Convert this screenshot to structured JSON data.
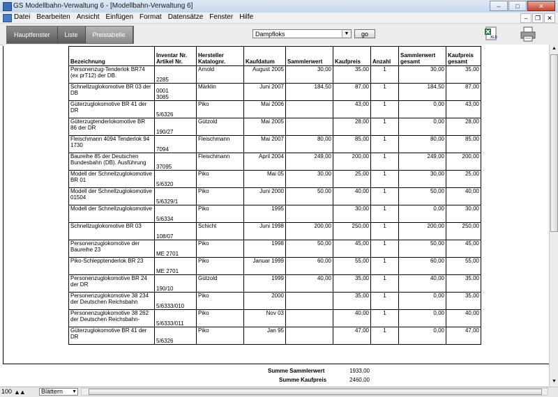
{
  "window": {
    "title": "GS Modellbahn-Verwaltung 6 - [Modellbahn-Verwaltung 6]",
    "buttons": {
      "min": "–",
      "max": "□",
      "close": "✕"
    }
  },
  "menu": [
    "Datei",
    "Bearbeiten",
    "Ansicht",
    "Einfügen",
    "Format",
    "Datensätze",
    "Fenster",
    "Hilfe"
  ],
  "mdi_buttons": {
    "min": "–",
    "restore": "❐",
    "close": "✕"
  },
  "tabs": [
    {
      "label": "Hauptfenster",
      "active": false
    },
    {
      "label": "Liste",
      "active": false
    },
    {
      "label": "Preistabelle",
      "active": true
    }
  ],
  "filter": {
    "selected": "Dampfloks",
    "go_label": "go"
  },
  "icons": {
    "xls": "excel-export-icon",
    "print": "printer-icon"
  },
  "columns": {
    "bezeichnung": "Bezeichnung",
    "inventar_l1": "Inventar Nr.",
    "inventar_l2": "Artikel Nr.",
    "hersteller_l1": "Hersteller",
    "hersteller_l2": "Katalognr.",
    "kaufdatum": "Kaufdatum",
    "sammlerwert": "Sammlerwert",
    "kaufpreis": "Kaufpreis",
    "anzahl": "Anzahl",
    "sammlerwert_gesamt_l1": "Sammlerwert",
    "sammlerwert_gesamt_l2": "gesamt",
    "kaufpreis_gesamt_l1": "Kaufpreis",
    "kaufpreis_gesamt_l2": "gesamt"
  },
  "rows": [
    {
      "bez": "Personenzug-Tenderlok BR74 (ex prT12) der DB.",
      "inv1": "",
      "inv2": "2285",
      "hersteller": "Arnold",
      "datum": "August 2005",
      "sammler": "30,00",
      "kauf": "35,00",
      "anzahl": "1",
      "sg": "30,00",
      "kg": "35,00"
    },
    {
      "bez": "Schnellzuglokomotive BR 03 der DB",
      "inv1": "0001",
      "inv2": "3085",
      "hersteller": "Märklin",
      "datum": "Juni 2007",
      "sammler": "184,50",
      "kauf": "87,00",
      "anzahl": "1",
      "sg": "184,50",
      "kg": "87,00"
    },
    {
      "bez": "Güterzuglokomotive BR 41 der DR",
      "inv1": "",
      "inv2": "5/6326",
      "hersteller": "Piko",
      "datum": "Mai 2006",
      "sammler": "",
      "kauf": "43,00",
      "anzahl": "1",
      "sg": "0,00",
      "kg": "43,00"
    },
    {
      "bez": "Güterzugtenderlokomotive BR 86 der DR",
      "inv1": "",
      "inv2": "190/27",
      "hersteller": "Gützold",
      "datum": "Mai 2005",
      "sammler": "",
      "kauf": "28,00",
      "anzahl": "1",
      "sg": "0,00",
      "kg": "28,00"
    },
    {
      "bez": "Fleischmann 4094 Tenderlok 94 1730",
      "inv1": "",
      "inv2": "7094",
      "hersteller": "Fleischmann",
      "datum": "Mai 2007",
      "sammler": "80,00",
      "kauf": "85,00",
      "anzahl": "1",
      "sg": "80,00",
      "kg": "85,00"
    },
    {
      "bez": "Baureihe 85 der Deutschen Bundesbahn (DB). Ausführung",
      "inv1": "",
      "inv2": "37095",
      "hersteller": "Fleischmann",
      "datum": "April 2004",
      "sammler": "249,00",
      "kauf": "200,00",
      "anzahl": "1",
      "sg": "249,00",
      "kg": "200,00"
    },
    {
      "bez": "Modell der Schnellzuglokomotive BR 01",
      "inv1": "",
      "inv2": "5/6320",
      "hersteller": "Piko",
      "datum": "Mai 05",
      "sammler": "30,00",
      "kauf": "25,00",
      "anzahl": "1",
      "sg": "30,00",
      "kg": "25,00"
    },
    {
      "bez": "Modell der Schnellzuglokomotive 01504",
      "inv1": "",
      "inv2": "5/6329/1",
      "hersteller": "Piko",
      "datum": "Juni 2000",
      "sammler": "50,00",
      "kauf": "40,00",
      "anzahl": "1",
      "sg": "50,00",
      "kg": "40,00"
    },
    {
      "bez": "Modell der Schnellzuglokomotive",
      "inv1": "",
      "inv2": "5/6334",
      "hersteller": "Piko",
      "datum": "1995",
      "sammler": "",
      "kauf": "30,00",
      "anzahl": "1",
      "sg": "0,00",
      "kg": "30,00"
    },
    {
      "bez": "Schnellzuglokomotive BR 03",
      "inv1": "",
      "inv2": "108/07",
      "hersteller": "Schicht",
      "datum": "Juni 1998",
      "sammler": "200,00",
      "kauf": "250,00",
      "anzahl": "1",
      "sg": "200,00",
      "kg": "250,00"
    },
    {
      "bez": "Personenzuglokomotive der Baureihe 23",
      "inv1": "",
      "inv2": "ME 2701",
      "hersteller": "Piko",
      "datum": "1998",
      "sammler": "50,00",
      "kauf": "45,00",
      "anzahl": "1",
      "sg": "50,00",
      "kg": "45,00"
    },
    {
      "bez": "Piko-Schlepptenderlok BR 23",
      "inv1": "",
      "inv2": "ME 2701",
      "hersteller": "Piko",
      "datum": "Januar 1999",
      "sammler": "60,00",
      "kauf": "55,00",
      "anzahl": "1",
      "sg": "60,00",
      "kg": "55,00"
    },
    {
      "bez": "Personenzuglokomotive BR 24 der DR",
      "inv1": "",
      "inv2": "190/10",
      "hersteller": "Gützold",
      "datum": "1999",
      "sammler": "40,00",
      "kauf": "35,00",
      "anzahl": "1",
      "sg": "40,00",
      "kg": "35,00"
    },
    {
      "bez": "Personenzuglokomotive 38 234 der Deutschen Reichsbahn",
      "inv1": "",
      "inv2": "5/6333/010",
      "hersteller": "Piko",
      "datum": "2000",
      "sammler": "",
      "kauf": "35,00",
      "anzahl": "1",
      "sg": "0,00",
      "kg": "35,00"
    },
    {
      "bez": "Personenzuglokomotive 38 262 der Deutschen Reichsbahn-",
      "inv1": "",
      "inv2": "5/6333/011",
      "hersteller": "Piko",
      "datum": "Nov 03",
      "sammler": "",
      "kauf": "40,00",
      "anzahl": "1",
      "sg": "0,00",
      "kg": "40,00"
    },
    {
      "bez": "Güterzuglokomotive BR 41 der DR",
      "inv1": "",
      "inv2": "5/6326",
      "hersteller": "Piko",
      "datum": "Jan 95",
      "sammler": "",
      "kauf": "47,00",
      "anzahl": "1",
      "sg": "0,00",
      "kg": "47,00"
    }
  ],
  "summary": {
    "sammlerwert_label": "Summe Sammlerwert",
    "sammlerwert_value": "1933,00",
    "kaufpreis_label": "Summe Kaufpreis",
    "kaufpreis_value": "2460,00"
  },
  "status": {
    "zoom": "100",
    "mode": "Blättern"
  }
}
